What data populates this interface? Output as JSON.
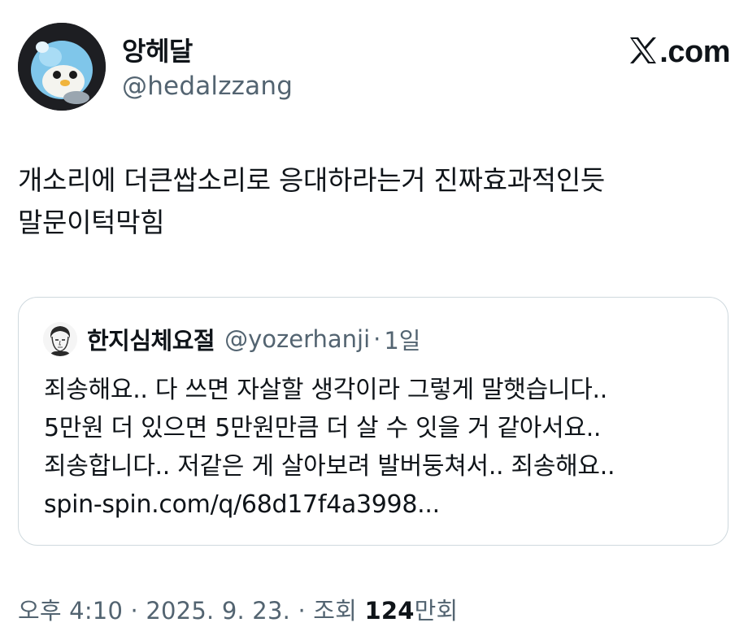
{
  "user": {
    "display_name": "앙헤달",
    "handle": "@hedalzzang",
    "avatar_icon": "penguin-plush-avatar"
  },
  "brand": {
    "domain_suffix": ".com",
    "logo_icon": "x-logo-icon"
  },
  "tweet": {
    "lines": [
      "개소리에 더큰쌉소리로 응대하라는거 진짜효과적인듯",
      "말문이턱막힘"
    ]
  },
  "quote": {
    "display_name": "한지심체요절",
    "handle": "@yozerhanji",
    "separator": "·",
    "time": "1일",
    "avatar_icon": "sketch-face-avatar",
    "lines": [
      "죄송해요.. 다 쓰면 자살할 생각이라 그렇게 말햇습니다..",
      "5만원 더 있으면 5만원만큼 더 살 수 잇을 거 같아서요..",
      "죄송합니다.. 저같은 게 살아보려 발버둥쳐서.. 죄송해요..",
      "spin-spin.com/q/68d17f4a3998..."
    ]
  },
  "meta": {
    "time": "오후 4:10",
    "sep1": " · ",
    "date": "2025. 9. 23.",
    "sep2": " · ",
    "views_label": "조회 ",
    "views_number": "124",
    "views_unit": "만회"
  },
  "colors": {
    "text": "#0f1419",
    "secondary": "#536471",
    "border": "#cfd9de"
  }
}
